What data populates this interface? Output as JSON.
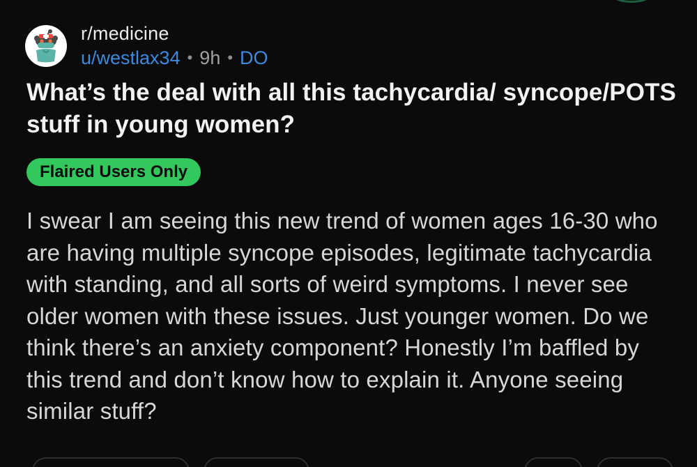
{
  "post": {
    "subreddit": "r/medicine",
    "author": "u/westlax34",
    "time": "9h",
    "author_flair": "DO",
    "title": "What’s the deal with all this tachycardia/ syncope/POTS stuff in young women?",
    "post_flair": "Flaired Users Only",
    "body": "I swear I am seeing this new trend of women ages 16-30 who are having multiple syncope episodes, legitimate tachycardia with standing, and all sorts of weird symptoms. I never see older women with these issues. Just younger women. Do we think there’s an anxiety component? Honestly I’m baffled by this trend and don’t know how to explain it. Anyone seeing similar stuff?",
    "separator": "•"
  },
  "colors": {
    "background": "#0b0b0b",
    "link_blue": "#3a8ae0",
    "flair_green": "#33c85e",
    "title_text": "#f2f2f2",
    "body_text": "#d6d7d9"
  },
  "icons": {
    "avatar": "snoo-medic-avatar-icon"
  }
}
